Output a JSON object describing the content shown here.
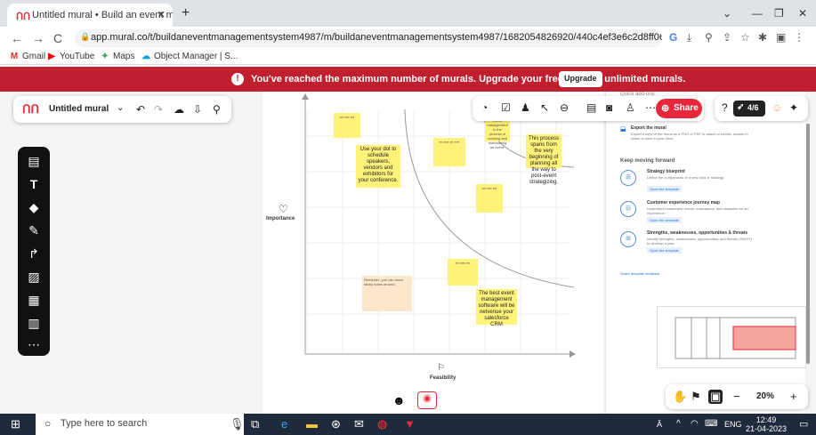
{
  "browser": {
    "tab_title": "Untitled mural • Build an event m",
    "new_tab": "+",
    "url": "app.mural.co/t/buildaneventmanagementsystem4987/m/buildaneventmanagementsystem4987/1682054826920/440c4ef3e6c2d8ff06c1dcd8b370d...",
    "window_controls": [
      "⌄",
      "—",
      "❐",
      "✕"
    ]
  },
  "bookmarks": [
    {
      "label": "Gmail",
      "icon": "gmail-icon",
      "color": "#d93025"
    },
    {
      "label": "YouTube",
      "icon": "youtube-icon",
      "color": "#ff0000"
    },
    {
      "label": "Maps",
      "icon": "maps-icon",
      "color": "#34a853"
    },
    {
      "label": "Object Manager | S...",
      "icon": "salesforce-icon",
      "color": "#00a1e0"
    }
  ],
  "banner": {
    "message": "You've reached the maximum number of murals. Upgrade your free plan for unlimited murals.",
    "button": "Upgrade",
    "color": "#c01f2f"
  },
  "mural": {
    "title": "Untitled mural",
    "share_label": "Share",
    "timer": "4/6",
    "zoom": "20%",
    "accent": "#e8273b"
  },
  "board": {
    "y_axis_label": "Importance",
    "x_axis_label": "Feasibility",
    "stickies": [
      {
        "text": "Use your dot to schedule speakers, vendors and exhibitors for your conference.",
        "big": true
      },
      {
        "text": "This process spans from the very beginning of planning all the way to post-event strategizing.",
        "big": true
      },
      {
        "text": "The best event management software will be netvenue your salesforce CRM",
        "big": true
      },
      {
        "text": "Event management is the process of creating and maintaining an event.",
        "big": false
      },
      {
        "text": "Reminder: you can move sticky notes around.",
        "big": false
      }
    ]
  },
  "right_panel": {
    "quick_add_title": "Quick add-ons",
    "export_title": "Export the mural",
    "export_desc": "Export a copy of the mural as a PNG or PDF to attach to emails, include in slides or save in your drive.",
    "keep_moving": "Keep moving forward",
    "templates": [
      {
        "name": "Strategy blueprint",
        "desc": "Define the components of a new idea or strategy.",
        "link": "Open the template"
      },
      {
        "name": "Customer experience journey map",
        "desc": "Understand customers' needs, motivations, and obstacles for an experience.",
        "link": "Open the template"
      },
      {
        "name": "Strengths, weaknesses, opportunities & threats",
        "desc": "Identify strengths, weaknesses, opportunities, and threats (SWOT) to develop a plan.",
        "link": "Open the template"
      }
    ],
    "feedback": "Share template feedback"
  },
  "taskbar": {
    "search_placeholder": "Type here to search",
    "lang": "ENG",
    "time": "12:49",
    "date": "21-04-2023"
  }
}
